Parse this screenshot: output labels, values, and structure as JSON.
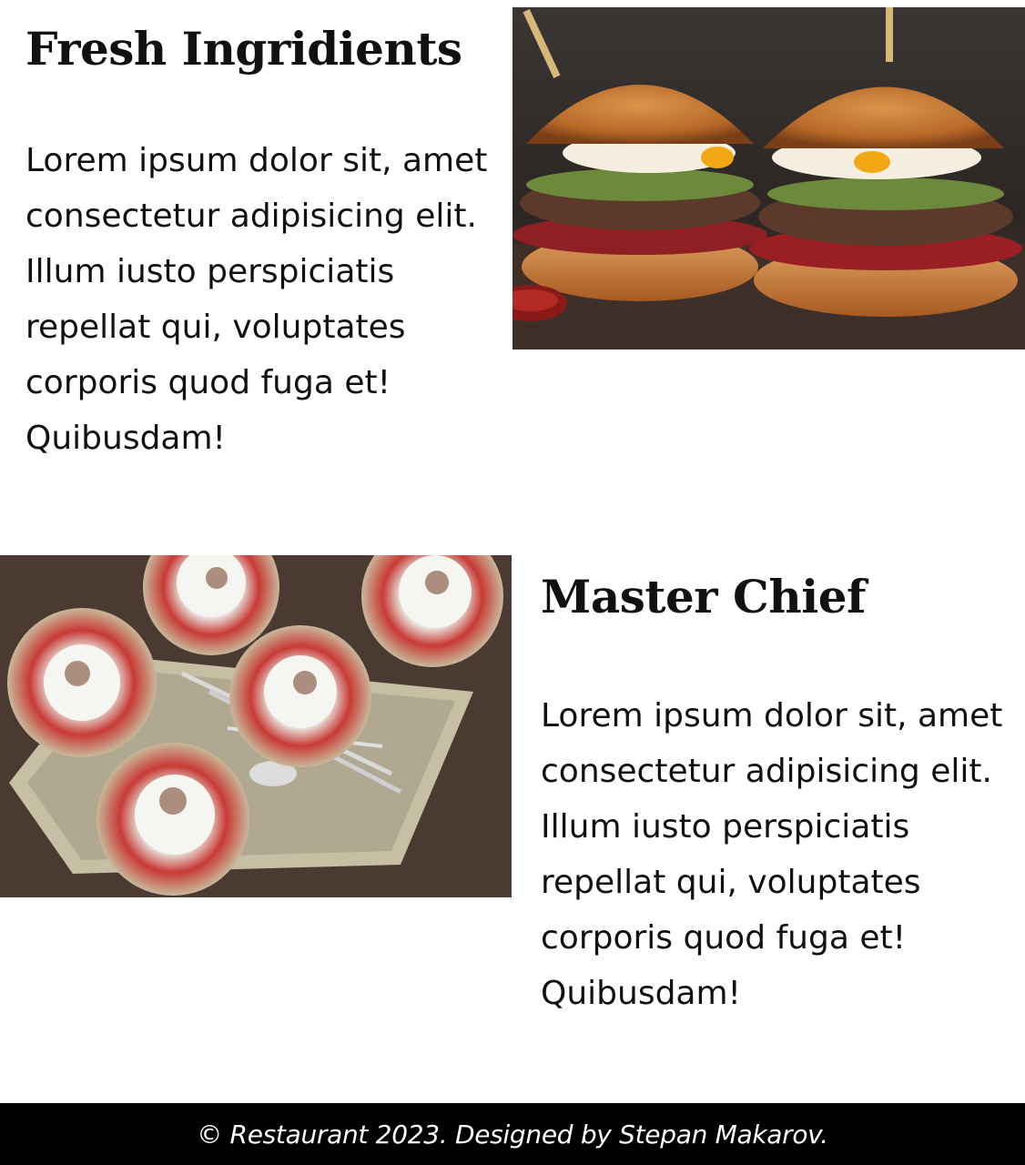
{
  "sections": [
    {
      "heading": "Fresh Ingridients",
      "paragraph": "Lorem ipsum dolor sit, amet consectetur adipisicing elit. Illum iusto perspiciatis repellat qui, voluptates corporis quod fuga et! Quibusdam!",
      "image_subject": "burgers"
    },
    {
      "heading": "Master Chief",
      "paragraph": "Lorem ipsum dolor sit, amet consectetur adipisicing elit. Illum iusto perspiciatis repellat qui, voluptates corporis quod fuga et! Quibusdam!",
      "image_subject": "strawberry-desserts"
    }
  ],
  "footer": {
    "text": "© Restaurant 2023. Designed by Stepan Makarov."
  }
}
